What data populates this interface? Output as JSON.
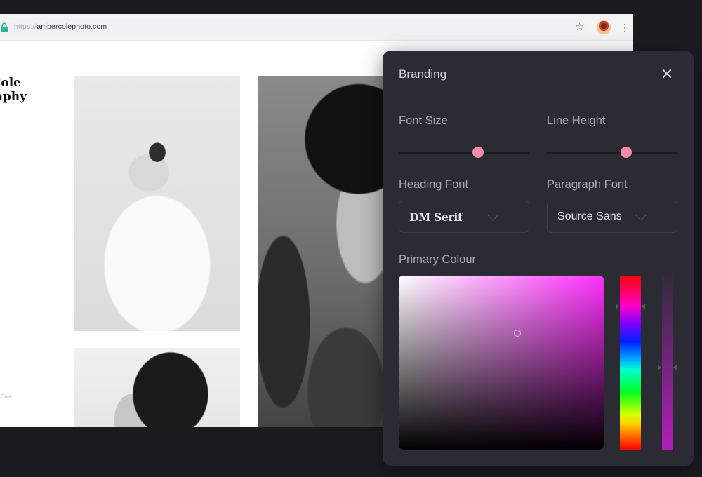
{
  "browser": {
    "url_scheme": "https://",
    "url_host": "ambercolephoto.com",
    "icons": [
      "lock-icon",
      "star-icon",
      "avatar",
      "more-menu-icon"
    ]
  },
  "site": {
    "brand_line1": "Cole",
    "brand_line2": "aphy",
    "footer_name": "mber Cole",
    "photos": [
      "woman-arms-raised",
      "man-portrait-closeup",
      "man-curly-hair-profile"
    ]
  },
  "panel": {
    "title": "Branding",
    "close_icon": "close-icon",
    "font_size": {
      "label": "Font Size",
      "value_fraction": 0.61
    },
    "line_height": {
      "label": "Line Height",
      "value_fraction": 0.61
    },
    "heading_font": {
      "label": "Heading Font",
      "value": "DM Serif"
    },
    "paragraph_font": {
      "label": "Paragraph Font",
      "value": "Source Sans"
    },
    "primary_colour": {
      "label": "Primary Colour",
      "hue_deg": 296,
      "saturation": 0.58,
      "brightness": 0.67,
      "alpha": 0.53,
      "hue_base_color": "#ff30ff"
    },
    "accent_color": "#f48aa4"
  }
}
